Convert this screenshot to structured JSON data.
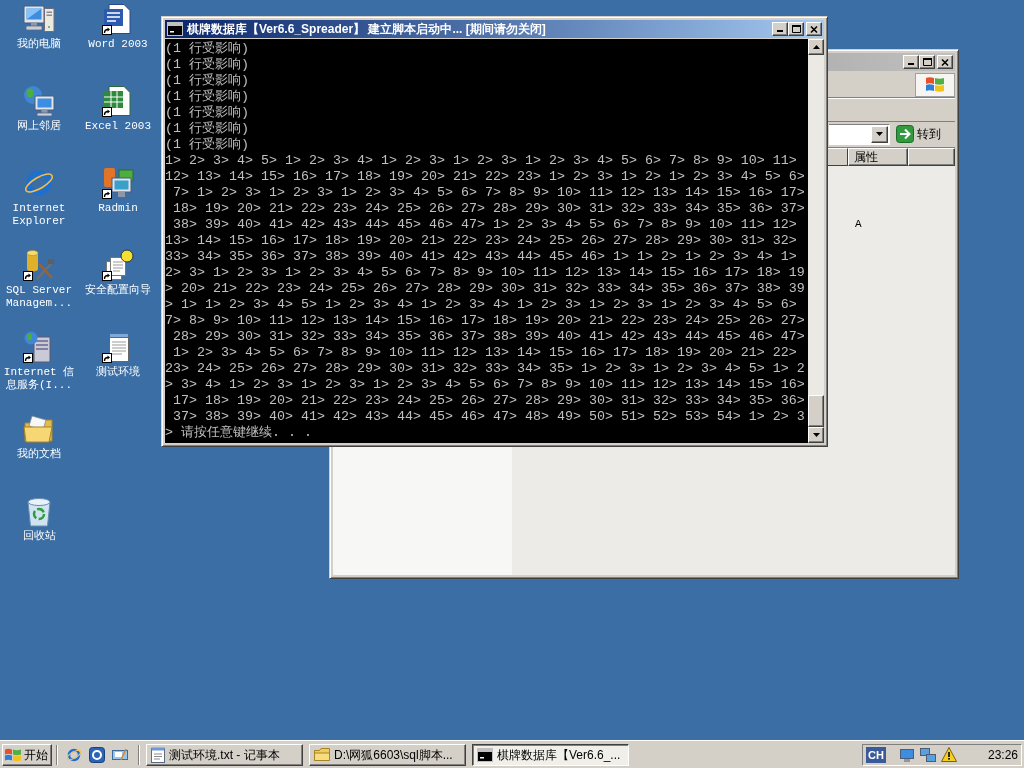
{
  "desktop_icons": [
    {
      "label": "我的电脑",
      "kind": "computer",
      "shortcut": false
    },
    {
      "label": "网上邻居",
      "kind": "network",
      "shortcut": false
    },
    {
      "label": "Internet Explorer",
      "kind": "browser",
      "shortcut": false
    },
    {
      "label": "SQL Server Managem...",
      "kind": "database",
      "shortcut": true
    },
    {
      "label": "Internet 信息服务(I...",
      "kind": "server",
      "shortcut": true
    },
    {
      "label": "我的文档",
      "kind": "documents",
      "shortcut": false
    },
    {
      "label": "回收站",
      "kind": "recycle",
      "shortcut": false
    },
    {
      "label": "Word 2003",
      "kind": "word",
      "shortcut": true
    },
    {
      "label": "Excel 2003",
      "kind": "excel",
      "shortcut": true
    },
    {
      "label": "Radmin",
      "kind": "remote",
      "shortcut": true
    },
    {
      "label": "安全配置向导",
      "kind": "wizard",
      "shortcut": true
    },
    {
      "label": "测试环境",
      "kind": "notepad",
      "shortcut": true
    }
  ],
  "explorer_window": {
    "go_button": "转到",
    "columns": [
      "属性"
    ],
    "rows": [
      {
        "attributes": "A"
      }
    ]
  },
  "console_window": {
    "title": "棋牌数据库【Ver6.6_Spreader】 建立脚本启动中... [期间请勿关闭]",
    "lines": [
      "(1 行受影响)",
      "(1 行受影响)",
      "(1 行受影响)",
      "(1 行受影响)",
      "(1 行受影响)",
      "(1 行受影响)",
      "(1 行受影响)",
      "1> 2> 3> 4> 5> 1> 2> 3> 4> 1> 2> 3> 1> 2> 3> 1> 2> 3> 4> 5> 6> 7> 8> 9> 10> 11>",
      "12> 13> 14> 15> 16> 17> 18> 19> 20> 21> 22> 23> 1> 2> 3> 1> 2> 1> 2> 3> 4> 5> 6>",
      " 7> 1> 2> 3> 1> 2> 3> 1> 2> 3> 4> 5> 6> 7> 8> 9> 10> 11> 12> 13> 14> 15> 16> 17>",
      " 18> 19> 20> 21> 22> 23> 24> 25> 26> 27> 28> 29> 30> 31> 32> 33> 34> 35> 36> 37>",
      " 38> 39> 40> 41> 42> 43> 44> 45> 46> 47> 1> 2> 3> 4> 5> 6> 7> 8> 9> 10> 11> 12>",
      "13> 14> 15> 16> 17> 18> 19> 20> 21> 22> 23> 24> 25> 26> 27> 28> 29> 30> 31> 32>",
      "33> 34> 35> 36> 37> 38> 39> 40> 41> 42> 43> 44> 45> 46> 1> 1> 2> 1> 2> 3> 4> 1>",
      "2> 3> 1> 2> 3> 1> 2> 3> 4> 5> 6> 7> 8> 9> 10> 11> 12> 13> 14> 15> 16> 17> 18> 19",
      "> 20> 21> 22> 23> 24> 25> 26> 27> 28> 29> 30> 31> 32> 33> 34> 35> 36> 37> 38> 39",
      "> 1> 1> 2> 3> 4> 5> 1> 2> 3> 4> 1> 2> 3> 4> 1> 2> 3> 1> 2> 3> 1> 2> 3> 4> 5> 6>",
      "7> 8> 9> 10> 11> 12> 13> 14> 15> 16> 17> 18> 19> 20> 21> 22> 23> 24> 25> 26> 27>",
      " 28> 29> 30> 31> 32> 33> 34> 35> 36> 37> 38> 39> 40> 41> 42> 43> 44> 45> 46> 47>",
      " 1> 2> 3> 4> 5> 6> 7> 8> 9> 10> 11> 12> 13> 14> 15> 16> 17> 18> 19> 20> 21> 22>",
      "23> 24> 25> 26> 27> 28> 29> 30> 31> 32> 33> 34> 35> 1> 2> 3> 1> 2> 3> 4> 5> 1> 2",
      "> 3> 4> 1> 2> 3> 1> 2> 3> 1> 2> 3> 4> 5> 6> 7> 8> 9> 10> 11> 12> 13> 14> 15> 16>",
      " 17> 18> 19> 20> 21> 22> 23> 24> 25> 26> 27> 28> 29> 30> 31> 32> 33> 34> 35> 36>",
      " 37> 38> 39> 40> 41> 42> 43> 44> 45> 46> 47> 48> 49> 50> 51> 52> 53> 54> 1> 2> 3",
      "> 请按任意键继续. . ."
    ]
  },
  "taskbar": {
    "start_button": "开始",
    "tasks": [
      {
        "label": "测试环境.txt - 记事本",
        "kind": "notepad",
        "selected": false
      },
      {
        "label": "D:\\网狐6603\\sql脚本...",
        "kind": "folder",
        "selected": false
      },
      {
        "label": "棋牌数据库【Ver6.6_...",
        "kind": "console",
        "selected": true
      }
    ],
    "language": "CH",
    "clock": "23:26"
  }
}
